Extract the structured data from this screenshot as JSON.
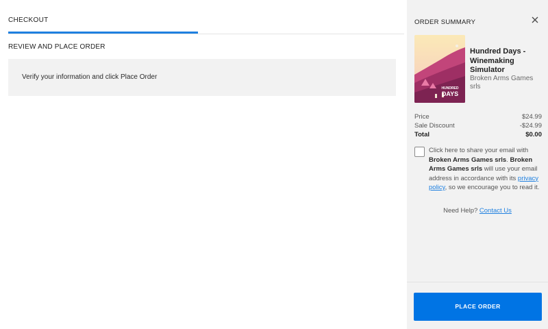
{
  "checkout": {
    "tab_label": "CHECKOUT",
    "section_title": "REVIEW AND PLACE ORDER",
    "info_text": "Verify your information and click Place Order"
  },
  "summary": {
    "title": "ORDER SUMMARY",
    "close_icon": "close-icon",
    "product": {
      "title": "Hundred Days - Winemaking Simulator",
      "developer": "Broken Arms Games srls",
      "cover_line1": "HUNDRED",
      "cover_line2": "DAYS"
    },
    "price_label": "Price",
    "price_value": "$24.99",
    "discount_label": "Sale Discount",
    "discount_value": "-$24.99",
    "total_label": "Total",
    "total_value": "$0.00",
    "consent": {
      "part1": "Click here to share your email with ",
      "company1": "Broken Arms Games srls",
      "part2": ". ",
      "company2": "Broken Arms Games srls",
      "part3": " will use your email address in accordance with its ",
      "privacy_link": "privacy policy",
      "part4": ", so we encourage you to read it."
    },
    "help_text": "Need Help? ",
    "contact_link": "Contact Us",
    "place_order_label": "PLACE ORDER"
  },
  "colors": {
    "accent": "#0074e4",
    "link": "#1f80e0",
    "sidebar_bg": "#f2f2f2"
  }
}
